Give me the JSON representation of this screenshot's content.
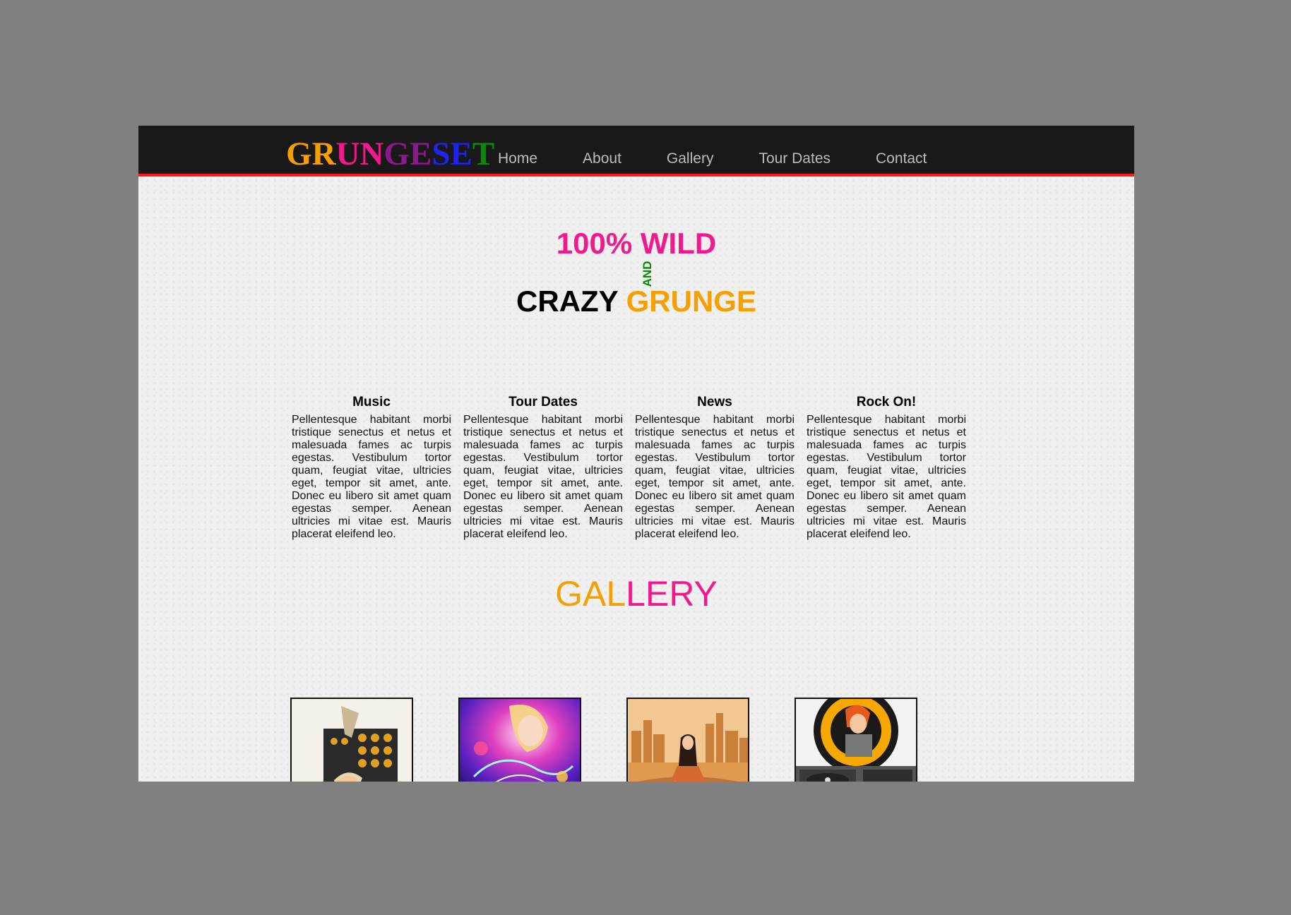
{
  "header": {
    "logo_letters": [
      {
        "ch": "G",
        "color": "#f5a000"
      },
      {
        "ch": "R",
        "color": "#f5a000"
      },
      {
        "ch": "U",
        "color": "#f01a8c"
      },
      {
        "ch": "N",
        "color": "#f01a8c"
      },
      {
        "ch": "G",
        "color": "#8a1a8a"
      },
      {
        "ch": "E",
        "color": "#8a1a8a"
      },
      {
        "ch": "S",
        "color": "#2222ee"
      },
      {
        "ch": "E",
        "color": "#2222ee"
      },
      {
        "ch": "T",
        "color": "#0a8a0a"
      }
    ],
    "nav": [
      "Home",
      "About",
      "Gallery",
      "Tour Dates",
      "Contact"
    ]
  },
  "hero": {
    "line1": "100% WILD",
    "and": "AND",
    "line2_word1": "CRAZY",
    "line2_word2": "GRUNGE"
  },
  "columns": [
    {
      "title": "Music",
      "text": "Pellentesque habitant morbi tristique senectus et netus et malesuada fames ac turpis egestas. Vestibulum tortor quam, feugiat vitae, ultricies eget, tempor sit amet, ante. Donec eu libero sit amet quam egestas semper. Aenean ultricies mi vitae est. Mauris placerat eleifend leo."
    },
    {
      "title": "Tour Dates",
      "text": "Pellentesque habitant morbi tristique senectus et netus et malesuada fames ac turpis egestas. Vestibulum tortor quam, feugiat vitae, ultricies eget, tempor sit amet, ante. Donec eu libero sit amet quam egestas semper. Aenean ultricies mi vitae est. Mauris placerat eleifend leo."
    },
    {
      "title": "News",
      "text": "Pellentesque habitant morbi tristique senectus et netus et malesuada fames ac turpis egestas. Vestibulum tortor quam, feugiat vitae, ultricies eget, tempor sit amet, ante. Donec eu libero sit amet quam egestas semper. Aenean ultricies mi vitae est. Mauris placerat eleifend leo."
    },
    {
      "title": "Rock On!",
      "text": "Pellentesque habitant morbi tristique senectus et netus et malesuada fames ac turpis egestas. Vestibulum tortor quam, feugiat vitae, ultricies eget, tempor sit amet, ante. Donec eu libero sit amet quam egestas semper. Aenean ultricies mi vitae est. Mauris placerat eleifend leo."
    }
  ],
  "gallery": {
    "title_part1": "GAL",
    "title_part2": "LERY"
  },
  "colors": {
    "orange": "#f5a000",
    "pink": "#f01a8c",
    "green": "#0a8a0a",
    "header_bg": "#191919",
    "header_border": "#ff1a1a"
  }
}
